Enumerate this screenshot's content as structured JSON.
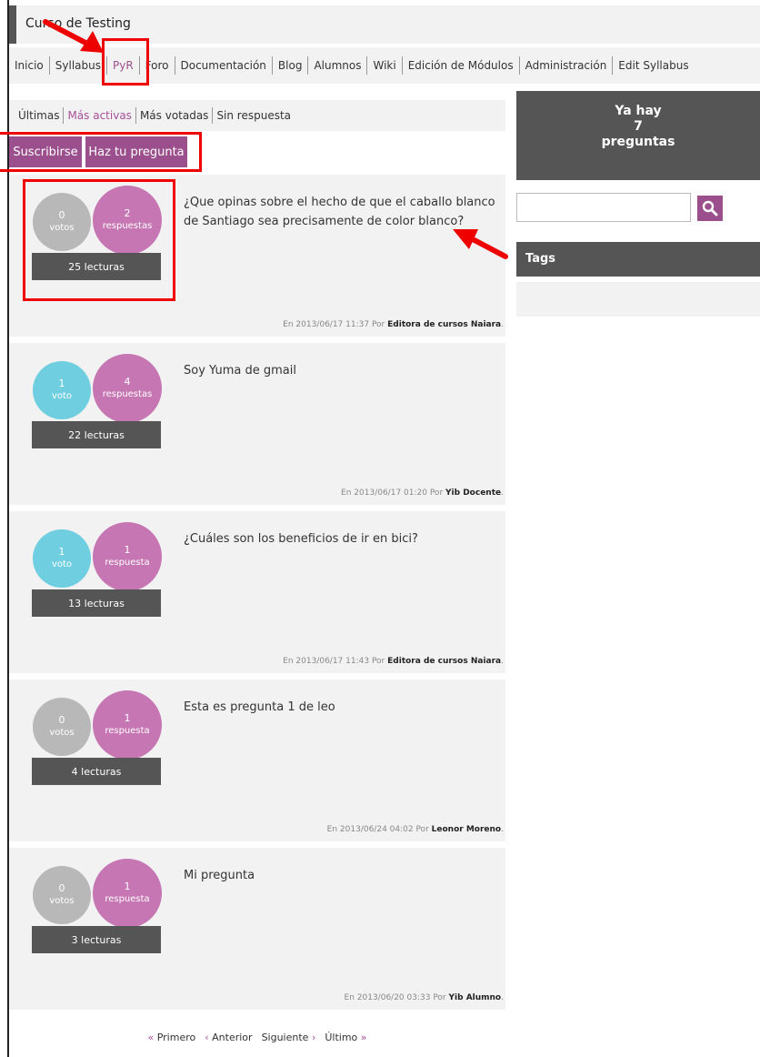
{
  "header": {
    "title": "Curso de Testing"
  },
  "nav": {
    "items": [
      {
        "label": "Inicio",
        "active": false
      },
      {
        "label": "Syllabus",
        "active": false
      },
      {
        "label": "PyR",
        "active": true
      },
      {
        "label": "Foro",
        "active": false
      },
      {
        "label": "Documentación",
        "active": false
      },
      {
        "label": "Blog",
        "active": false
      },
      {
        "label": "Alumnos",
        "active": false
      },
      {
        "label": "Wiki",
        "active": false
      },
      {
        "label": "Edición de Módulos",
        "active": false
      },
      {
        "label": "Administración",
        "active": false
      },
      {
        "label": "Edit Syllabus",
        "active": false
      }
    ]
  },
  "filters": [
    "Últimas",
    "Más activas",
    "Más votadas",
    "Sin respuesta"
  ],
  "active_filter": "Más activas",
  "buttons": {
    "subscribe": "Suscribirse",
    "ask": "Haz tu pregunta"
  },
  "questions": [
    {
      "votes": "0",
      "votes_label": "votos",
      "answers": "2",
      "answers_label": "respuestas",
      "reads": "25 lecturas",
      "title": "¿Que opinas sobre el hecho de que el caballo blanco de Santiago sea precisamente de color blanco?",
      "meta_prefix": "En 2013/06/17 11:37 Por",
      "author": "Editora de cursos Naiara"
    },
    {
      "votes": "1",
      "votes_label": "voto",
      "answers": "4",
      "answers_label": "respuestas",
      "reads": "22 lecturas",
      "title": "Soy Yuma de gmail",
      "meta_prefix": "En 2013/06/17 01:20 Por",
      "author": "Yib Docente"
    },
    {
      "votes": "1",
      "votes_label": "voto",
      "answers": "1",
      "answers_label": "respuesta",
      "reads": "13 lecturas",
      "title": "¿Cuáles son los beneficios de ir en bici?",
      "meta_prefix": "En 2013/06/17 11:43 Por",
      "author": "Editora de cursos Naiara"
    },
    {
      "votes": "0",
      "votes_label": "votos",
      "answers": "1",
      "answers_label": "respuesta",
      "reads": "4 lecturas",
      "title": "Esta es pregunta 1 de leo",
      "meta_prefix": "En 2013/06/24 04:02 Por",
      "author": "Leonor Moreno"
    },
    {
      "votes": "0",
      "votes_label": "votos",
      "answers": "1",
      "answers_label": "respuesta",
      "reads": "3 lecturas",
      "title": "Mi pregunta",
      "meta_prefix": "En 2013/06/20 03:33 Por",
      "author": "Yib Alumno"
    }
  ],
  "pager": {
    "first": "Primero",
    "prev": "Anterior",
    "next": "Siguiente",
    "last": "Último"
  },
  "sidebar": {
    "count_line1": "Ya hay",
    "count_value": "7",
    "count_line3": "preguntas",
    "search_placeholder": "",
    "tags_title": "Tags"
  },
  "colors": {
    "accent": "#9b4f8c",
    "answers": "#c676b3",
    "votes_zero": "#b8b8b8",
    "votes_positive": "#6fcfe0",
    "dark": "#555555",
    "annotation": "#ee0000"
  },
  "icons": {
    "search": "search-icon",
    "first": "double-chevron-left-icon",
    "prev": "chevron-left-icon",
    "next": "chevron-right-icon",
    "last": "double-chevron-right-icon"
  }
}
